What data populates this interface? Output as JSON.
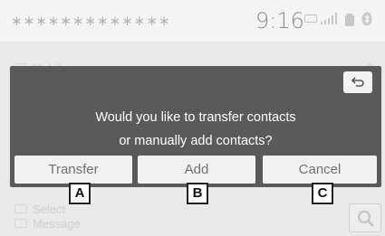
{
  "status_bar": {
    "network_name": "∗∗∗∗∗∗∗∗∗∗∗∗∗",
    "time": "9:16",
    "icons": [
      "dcm-icon",
      "signal-icon",
      "battery-icon",
      "bluetooth-icon"
    ]
  },
  "background_menu": {
    "items": [
      {
        "label": "Mobile",
        "icon": "phone-icon"
      },
      {
        "label": "Select",
        "icon": "contact-icon"
      },
      {
        "label": "Message",
        "icon": "message-icon"
      }
    ]
  },
  "dialog": {
    "message_line1": "Would you like to transfer contacts",
    "message_line2": "or manually add contacts?",
    "buttons": {
      "transfer": "Transfer",
      "add": "Add",
      "cancel": "Cancel"
    },
    "back_icon": "back-arrow-icon"
  },
  "callouts": [
    "A",
    "B",
    "C"
  ],
  "colors": {
    "dialog_bg": "#5a5a5a",
    "button_bg": "#f1f1f1",
    "button_text": "#707070",
    "status_text": "#8c8c8c"
  }
}
